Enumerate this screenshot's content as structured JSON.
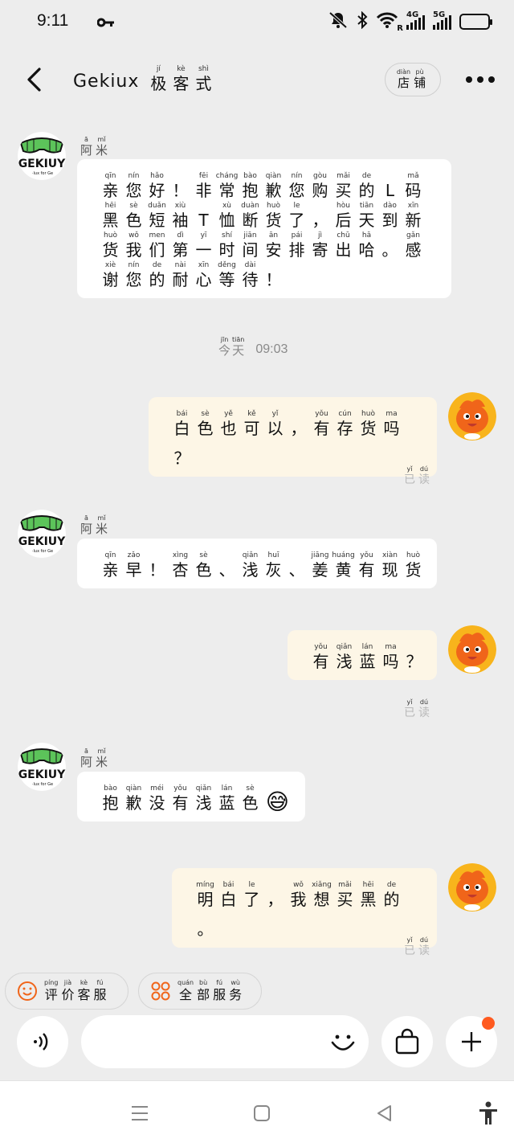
{
  "status_bar": {
    "time": "9:11",
    "network_1": "4G",
    "network_2": "5G",
    "roaming": "R",
    "icons": [
      "key-icon",
      "mute-icon",
      "bluetooth-icon",
      "wifi-icon",
      "signal-icon",
      "battery-icon"
    ]
  },
  "header": {
    "title_latin": "Gekiux",
    "title_cn": [
      {
        "h": "极",
        "p": "jí"
      },
      {
        "h": "客",
        "p": "kè"
      },
      {
        "h": "式",
        "p": "shì"
      }
    ],
    "store_button": [
      {
        "h": "店",
        "p": "diàn"
      },
      {
        "h": "铺",
        "p": "pù"
      }
    ]
  },
  "shop": {
    "avatar_text": "GEKIUY",
    "avatar_subtext": "·lux for Ge",
    "name": [
      {
        "h": "阿",
        "p": "ā"
      },
      {
        "h": "米",
        "p": "mǐ"
      }
    ]
  },
  "messages": [
    {
      "side": "left",
      "chars": [
        {
          "h": "亲",
          "p": "qīn"
        },
        {
          "h": "您",
          "p": "nín"
        },
        {
          "h": "好",
          "p": "hǎo"
        },
        {
          "h": "！",
          "p": ""
        },
        {
          "h": "非",
          "p": "fēi"
        },
        {
          "h": "常",
          "p": "cháng"
        },
        {
          "h": "抱",
          "p": "bào"
        },
        {
          "h": "歉",
          "p": "qiàn"
        },
        {
          "h": "您",
          "p": "nín"
        },
        {
          "h": "购",
          "p": "gòu"
        },
        {
          "h": "买",
          "p": "mǎi"
        },
        {
          "h": "的",
          "p": "de"
        },
        {
          "h": "L",
          "p": ""
        },
        {
          "h": "码",
          "p": "mǎ"
        },
        {
          "h": "黑",
          "p": "hēi"
        },
        {
          "h": "色",
          "p": "sè"
        },
        {
          "h": "短",
          "p": "duǎn"
        },
        {
          "h": "袖",
          "p": "xiù"
        },
        {
          "h": "T",
          "p": ""
        },
        {
          "h": "恤",
          "p": "xù"
        },
        {
          "h": "断",
          "p": "duàn"
        },
        {
          "h": "货",
          "p": "huò"
        },
        {
          "h": "了",
          "p": "le"
        },
        {
          "h": "，",
          "p": ""
        },
        {
          "h": "后",
          "p": "hòu"
        },
        {
          "h": "天",
          "p": "tiān"
        },
        {
          "h": "到",
          "p": "dào"
        },
        {
          "h": "新",
          "p": "xīn"
        },
        {
          "h": "货",
          "p": "huò"
        },
        {
          "h": "我",
          "p": "wǒ"
        },
        {
          "h": "们",
          "p": "men"
        },
        {
          "h": "第",
          "p": "dì"
        },
        {
          "h": "一",
          "p": "yī"
        },
        {
          "h": "时",
          "p": "shí"
        },
        {
          "h": "间",
          "p": "jiān"
        },
        {
          "h": "安",
          "p": "ān"
        },
        {
          "h": "排",
          "p": "pái"
        },
        {
          "h": "寄",
          "p": "jì"
        },
        {
          "h": "出",
          "p": "chū"
        },
        {
          "h": "哈",
          "p": "hā"
        },
        {
          "h": "。",
          "p": ""
        },
        {
          "h": "感",
          "p": "gǎn"
        },
        {
          "h": "谢",
          "p": "xiè"
        },
        {
          "h": "您",
          "p": "nín"
        },
        {
          "h": "的",
          "p": "de"
        },
        {
          "h": "耐",
          "p": "nài"
        },
        {
          "h": "心",
          "p": "xīn"
        },
        {
          "h": "等",
          "p": "děng"
        },
        {
          "h": "待",
          "p": "dài"
        },
        {
          "h": "！",
          "p": ""
        }
      ]
    },
    {
      "side": "right",
      "read": [
        {
          "h": "已",
          "p": "yǐ"
        },
        {
          "h": "读",
          "p": "dú"
        }
      ],
      "chars": [
        {
          "h": "白",
          "p": "bái"
        },
        {
          "h": "色",
          "p": "sè"
        },
        {
          "h": "也",
          "p": "yě"
        },
        {
          "h": "可",
          "p": "kě"
        },
        {
          "h": "以",
          "p": "yǐ"
        },
        {
          "h": "，",
          "p": ""
        },
        {
          "h": "有",
          "p": "yǒu"
        },
        {
          "h": "存",
          "p": "cún"
        },
        {
          "h": "货",
          "p": "huò"
        },
        {
          "h": "吗",
          "p": "ma"
        },
        {
          "h": "？",
          "p": ""
        }
      ]
    },
    {
      "side": "left",
      "chars": [
        {
          "h": "亲",
          "p": "qīn"
        },
        {
          "h": "早",
          "p": "zǎo"
        },
        {
          "h": "！",
          "p": ""
        },
        {
          "h": "杏",
          "p": "xìng"
        },
        {
          "h": "色",
          "p": "sè"
        },
        {
          "h": "、",
          "p": ""
        },
        {
          "h": "浅",
          "p": "qiǎn"
        },
        {
          "h": "灰",
          "p": "huī"
        },
        {
          "h": "、",
          "p": ""
        },
        {
          "h": "姜",
          "p": "jiāng"
        },
        {
          "h": "黄",
          "p": "huáng"
        },
        {
          "h": "有",
          "p": "yǒu"
        },
        {
          "h": "现",
          "p": "xiàn"
        },
        {
          "h": "货",
          "p": "huò"
        }
      ]
    },
    {
      "side": "right",
      "read": [
        {
          "h": "已",
          "p": "yǐ"
        },
        {
          "h": "读",
          "p": "dú"
        }
      ],
      "chars": [
        {
          "h": "有",
          "p": "yǒu"
        },
        {
          "h": "浅",
          "p": "qiǎn"
        },
        {
          "h": "蓝",
          "p": "lán"
        },
        {
          "h": "吗",
          "p": "ma"
        },
        {
          "h": "？",
          "p": ""
        }
      ]
    },
    {
      "side": "left",
      "emoji": "😅",
      "chars": [
        {
          "h": "抱",
          "p": "bào"
        },
        {
          "h": "歉",
          "p": "qiàn"
        },
        {
          "h": "没",
          "p": "méi"
        },
        {
          "h": "有",
          "p": "yǒu"
        },
        {
          "h": "浅",
          "p": "qiǎn"
        },
        {
          "h": "蓝",
          "p": "lán"
        },
        {
          "h": "色",
          "p": "sè"
        }
      ]
    },
    {
      "side": "right",
      "read": [
        {
          "h": "已",
          "p": "yǐ"
        },
        {
          "h": "读",
          "p": "dú"
        }
      ],
      "chars": [
        {
          "h": "明",
          "p": "míng"
        },
        {
          "h": "白",
          "p": "bái"
        },
        {
          "h": "了",
          "p": "le"
        },
        {
          "h": "，",
          "p": ""
        },
        {
          "h": "我",
          "p": "wǒ"
        },
        {
          "h": "想",
          "p": "xiǎng"
        },
        {
          "h": "买",
          "p": "mǎi"
        },
        {
          "h": "黑",
          "p": "hēi"
        },
        {
          "h": "的",
          "p": "de"
        },
        {
          "h": "。",
          "p": ""
        }
      ]
    }
  ],
  "timestamp": {
    "day": [
      {
        "h": "今",
        "p": "jīn"
      },
      {
        "h": "天",
        "p": "tiān"
      }
    ],
    "time": "09:03"
  },
  "quick_actions": [
    {
      "icon": "smile-face-icon",
      "label": [
        {
          "h": "评",
          "p": "píng"
        },
        {
          "h": "价",
          "p": "jià"
        },
        {
          "h": "客",
          "p": "kè"
        },
        {
          "h": "服",
          "p": "fú"
        }
      ]
    },
    {
      "icon": "grid-services-icon",
      "label": [
        {
          "h": "全",
          "p": "quán"
        },
        {
          "h": "部",
          "p": "bù"
        },
        {
          "h": "服",
          "p": "fú"
        },
        {
          "h": "务",
          "p": "wù"
        }
      ]
    }
  ],
  "input": {
    "value": "",
    "placeholder": ""
  },
  "colors": {
    "accent": "#f0651a",
    "background": "#ededed",
    "bubble_left": "#ffffff",
    "bubble_right": "#fdf6e6",
    "badge": "#ff5a1f"
  }
}
